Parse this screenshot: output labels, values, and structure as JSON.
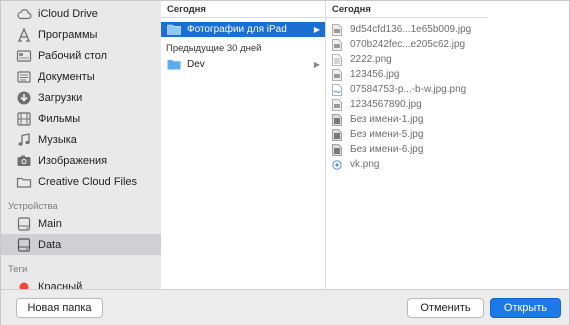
{
  "sidebar": {
    "favorites": [
      {
        "label": "iCloud Drive",
        "icon": "cloud-icon"
      },
      {
        "label": "Программы",
        "icon": "applications-icon"
      },
      {
        "label": "Рабочий стол",
        "icon": "desktop-icon"
      },
      {
        "label": "Документы",
        "icon": "documents-icon"
      },
      {
        "label": "Загрузки",
        "icon": "downloads-icon"
      },
      {
        "label": "Фильмы",
        "icon": "movies-icon"
      },
      {
        "label": "Музыка",
        "icon": "music-icon"
      },
      {
        "label": "Изображения",
        "icon": "pictures-icon"
      },
      {
        "label": "Creative Cloud Files",
        "icon": "folder-icon"
      }
    ],
    "devices_header": "Устройства",
    "devices": [
      {
        "label": "Main",
        "icon": "disk-icon"
      },
      {
        "label": "Data",
        "icon": "disk-icon",
        "selected": true
      }
    ],
    "tags_header": "Теги",
    "tags": [
      {
        "label": "Красный",
        "color": "#f0453a"
      }
    ]
  },
  "column1": {
    "header": "Сегодня",
    "selected_item": "Фотографии для iPad",
    "group2_label": "Предыдущие 30 дней",
    "item2": "Dev"
  },
  "column2": {
    "header": "Сегодня",
    "files": [
      {
        "name": "9d54cfd136...1e65b009.jpg",
        "icon": "jpg-file-icon"
      },
      {
        "name": "070b242fec...e205c62.jpg",
        "icon": "jpg-file-icon"
      },
      {
        "name": "2222.png",
        "icon": "png-file-icon"
      },
      {
        "name": "123456.jpg",
        "icon": "jpg-file-icon"
      },
      {
        "name": "07584753-p...-b-w.jpg.png",
        "icon": "png-file-icon"
      },
      {
        "name": "1234567890.jpg",
        "icon": "jpg-file-icon"
      },
      {
        "name": "Без имени-1.jpg",
        "icon": "jpg-file-icon"
      },
      {
        "name": "Без имени-5.jpg",
        "icon": "jpg-file-icon"
      },
      {
        "name": "Без имени-6.jpg",
        "icon": "jpg-file-icon"
      },
      {
        "name": "vk.png",
        "icon": "png-file-icon"
      }
    ]
  },
  "footer": {
    "new_folder": "Новая папка",
    "cancel": "Отменить",
    "open": "Открыть"
  },
  "colors": {
    "selection": "#1a6ed4",
    "primary_button": "#1d79e8",
    "folder_blue": "#5aaef0",
    "tag_red": "#f0453a"
  }
}
